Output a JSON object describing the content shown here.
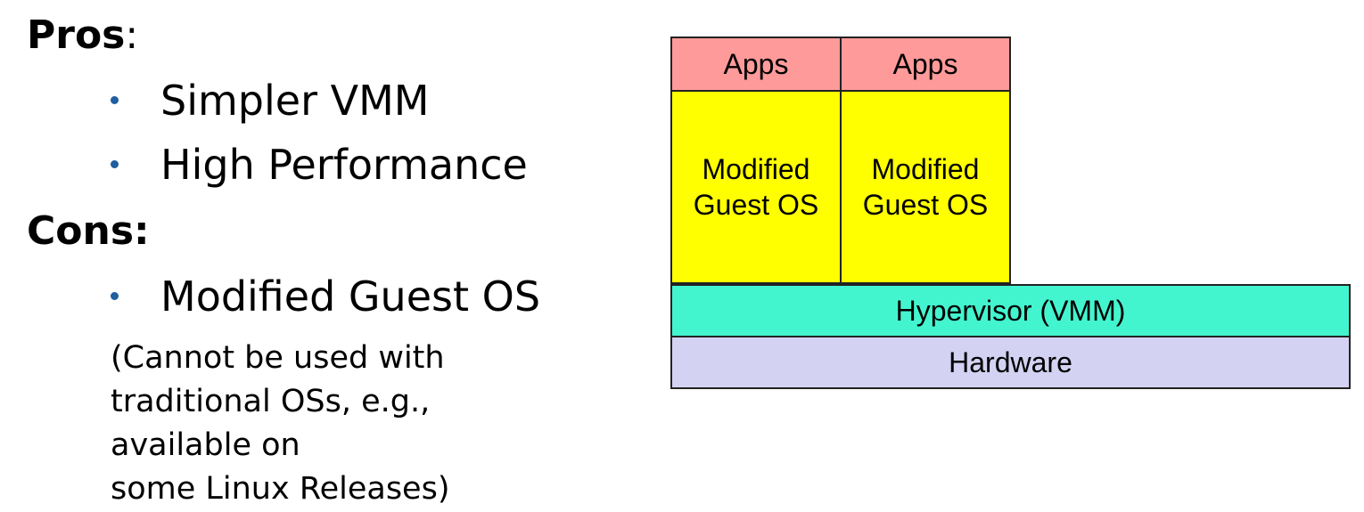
{
  "text": {
    "pros_heading": "Pros",
    "pros_colon": ":",
    "pros_items": [
      "Simpler VMM",
      "High Performance"
    ],
    "cons_heading": "Cons:",
    "cons_items": [
      "Modified Guest OS"
    ],
    "cons_note_lines": [
      "(Cannot be used with",
      "traditional OSs, e.g.,",
      "available on",
      "some Linux Releases)"
    ]
  },
  "diagram": {
    "columns": [
      {
        "apps_label": "Apps",
        "os_label_lines": [
          "Modified",
          "Guest OS"
        ]
      },
      {
        "apps_label": "Apps",
        "os_label_lines": [
          "Modified",
          "Guest OS"
        ]
      }
    ],
    "hypervisor_label": "Hypervisor (VMM)",
    "hardware_label": "Hardware"
  },
  "colors": {
    "apps": "#ff9a9a",
    "guest_os": "#ffff00",
    "hypervisor": "#43f5cf",
    "hardware": "#d4d2f2",
    "bullet": "#1f5fa0"
  }
}
